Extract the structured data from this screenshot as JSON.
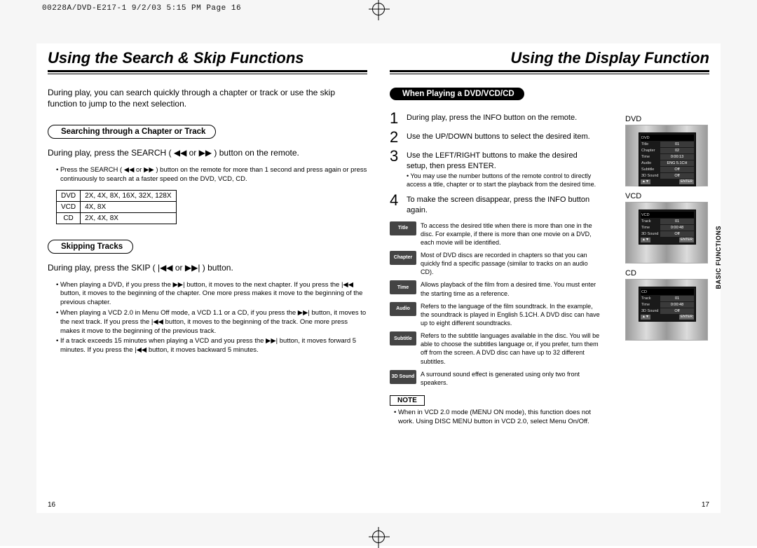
{
  "print_header": "00228A/DVD-E217-1  9/2/03 5:15 PM  Page 16",
  "left": {
    "title": "Using the Search & Skip Functions",
    "intro": "During play, you can search quickly through a chapter or track or use the skip function to jump to the next selection.",
    "section1": {
      "heading": "Searching through a Chapter or Track",
      "line": "During play, press the SEARCH ( ◀◀ or ▶▶ ) button on the remote.",
      "fine": "Press the SEARCH ( ◀◀ or ▶▶ ) button on the remote for more than 1 second and press again or press continuously to search at a faster speed on the DVD, VCD, CD.",
      "speeds": [
        [
          "DVD",
          "2X, 4X, 8X, 16X, 32X, 128X"
        ],
        [
          "VCD",
          "4X, 8X"
        ],
        [
          "CD",
          "2X, 4X, 8X"
        ]
      ]
    },
    "section2": {
      "heading": "Skipping Tracks",
      "line": "During play, press the SKIP ( |◀◀ or ▶▶| ) button.",
      "bullets": [
        "When playing a DVD, if you press the ▶▶| button, it moves to the next chapter. If you press the |◀◀ button, it moves to the beginning of the chapter. One more press makes it move to the beginning of the previous chapter.",
        "When playing a VCD 2.0 in Menu Off mode, a VCD 1.1 or a CD, if you press the ▶▶| button, it moves to the next track. If you press the |◀◀ button, it moves to the beginning of the track. One more press makes it move to the beginning of the previous track.",
        "If a track exceeds 15 minutes when playing a VCD and you press the ▶▶| button, it moves forward 5 minutes. If you press the |◀◀ button, it moves backward 5 minutes."
      ]
    },
    "page_no": "16"
  },
  "right": {
    "title": "Using the Display Function",
    "section_heading": "When Playing a DVD/VCD/CD",
    "steps": [
      {
        "n": "1",
        "t": "During play, press the INFO button on the remote."
      },
      {
        "n": "2",
        "t": "Use the UP/DOWN buttons to select the desired item."
      },
      {
        "n": "3",
        "t": "Use the LEFT/RIGHT buttons to make the desired setup, then press ENTER.",
        "sub": "You may use the number buttons of the remote control to directly access a title, chapter or to start the playback from the desired time."
      },
      {
        "n": "4",
        "t": "To make the screen disappear, press the INFO button again."
      }
    ],
    "defs": [
      {
        "tag": "Title",
        "txt": "To access the desired title when there is more than one in the disc. For example, if there is more than one movie on a DVD, each movie will be identified."
      },
      {
        "tag": "Chapter",
        "txt": "Most of DVD discs are recorded in chapters so that you can quickly find a specific passage (similar to tracks on an audio CD)."
      },
      {
        "tag": "Time",
        "txt": "Allows playback of the film from a desired time. You must enter the starting time as a reference."
      },
      {
        "tag": "Audio",
        "txt": "Refers to the language of the film soundtrack. In the example, the soundtrack is played in English 5.1CH. A DVD disc can have up to eight different soundtracks."
      },
      {
        "tag": "Subtitle",
        "txt": "Refers to the subtitle languages available in the disc. You will be able to choose the subtitles language or, if you prefer, turn them off from the screen. A DVD disc can have up to 32 different subtitles."
      },
      {
        "tag": "3D Sound",
        "txt": "A surround sound effect is generated using only two front speakers."
      }
    ],
    "note_label": "NOTE",
    "note_text": "When in VCD 2.0 mode (MENU ON mode), this function does not work. Using DISC MENU button in VCD 2.0, select Menu On/Off.",
    "osd_labels": {
      "dvd": "DVD",
      "vcd": "VCD",
      "cd": "CD"
    },
    "osd_dvd": {
      "header": "DVD",
      "rows": [
        {
          "lab": "Title",
          "val": "01"
        },
        {
          "lab": "Chapter",
          "val": "02"
        },
        {
          "lab": "Time",
          "val": "0:00:13"
        },
        {
          "lab": "Audio",
          "val": "ENG 5.1CH"
        },
        {
          "lab": "Subtitle",
          "val": "Off"
        },
        {
          "lab": "3D Sound",
          "val": "Off"
        }
      ],
      "btns": [
        "▲▼",
        "ENTER"
      ]
    },
    "osd_vcd": {
      "header": "VCD",
      "rows": [
        {
          "lab": "Track",
          "val": "01"
        },
        {
          "lab": "Time",
          "val": "0:00:48"
        },
        {
          "lab": "3D Sound",
          "val": "Off"
        }
      ],
      "btns": [
        "▲▼",
        "ENTER"
      ]
    },
    "osd_cd": {
      "header": "CD",
      "rows": [
        {
          "lab": "Track",
          "val": "01"
        },
        {
          "lab": "Time",
          "val": "0:00:48"
        },
        {
          "lab": "3D Sound",
          "val": "Off"
        }
      ],
      "btns": [
        "▲▼",
        "ENTER"
      ]
    },
    "side_tab": "BASIC\nFUNCTIONS",
    "page_no": "17"
  }
}
